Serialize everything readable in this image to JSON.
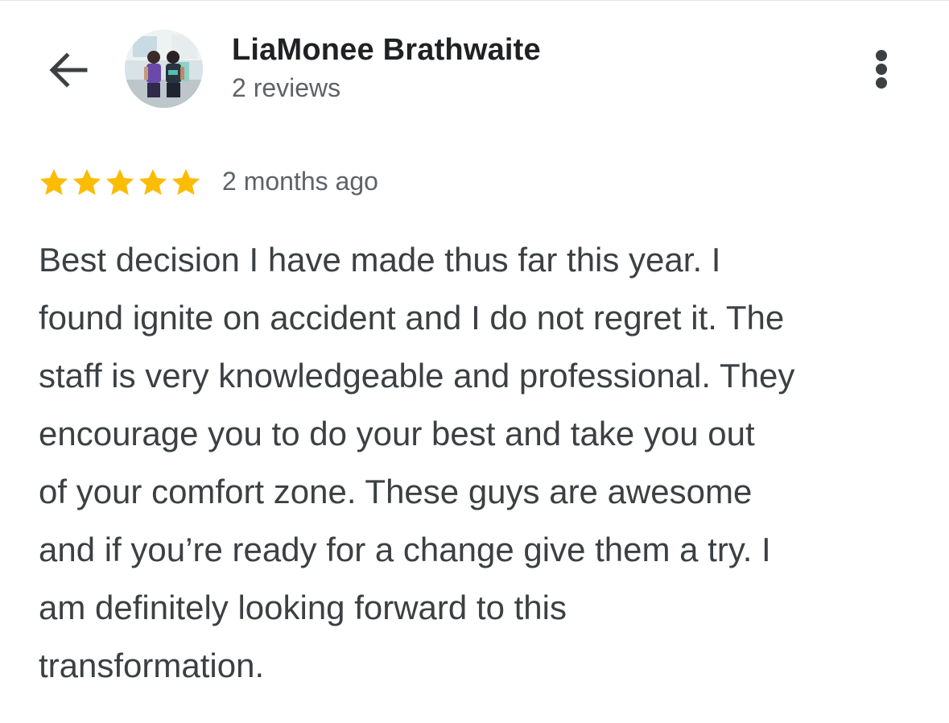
{
  "header": {
    "back_icon": "arrow-left-icon",
    "author_name": "LiaMonee Brathwaite",
    "review_count": "2 reviews",
    "more_icon": "more-vertical-icon"
  },
  "review": {
    "rating": 5,
    "rating_max": 5,
    "star_color": "#FBBC04",
    "time": "2 months ago",
    "lines": [
      "Best decision I have made thus far this year. I",
      "found ignite on accident and I do not regret it. The",
      "staff is very knowledgeable and professional. They",
      "encourage you to do your best and take you out",
      "of your comfort zone. These guys are awesome",
      "and if you’re ready for a change give them a try. I",
      "am definitely looking forward to this",
      "transformation."
    ]
  },
  "colors": {
    "text_primary": "#202124",
    "text_secondary": "#5f6368",
    "body_text": "#3c4043"
  }
}
